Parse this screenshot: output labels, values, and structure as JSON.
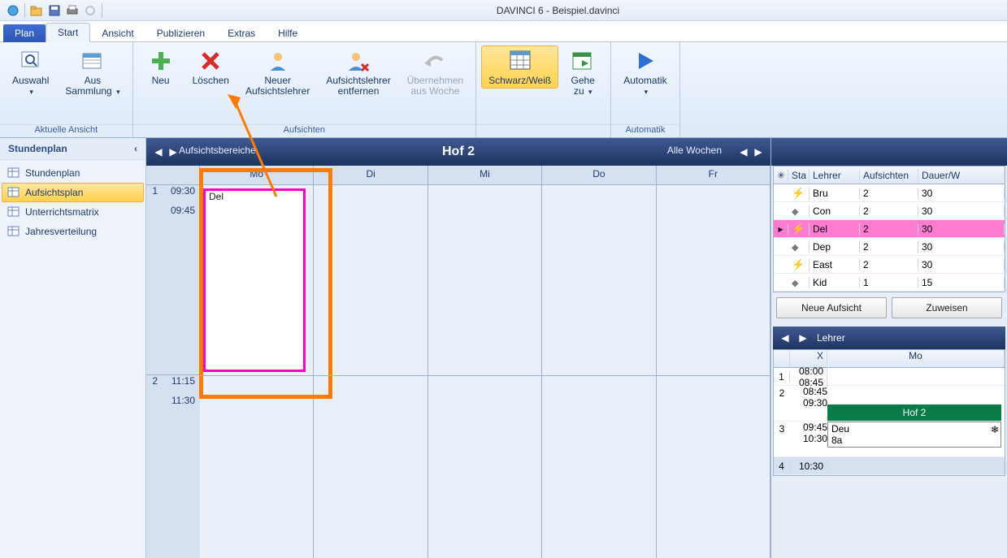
{
  "app_title": "DAVINCI 6 - Beispiel.davinci",
  "tabs": {
    "file": "Plan",
    "start": "Start",
    "ansicht": "Ansicht",
    "publizieren": "Publizieren",
    "extras": "Extras",
    "hilfe": "Hilfe"
  },
  "ribbon": {
    "aktuelle_ansicht": {
      "label": "Aktuelle Ansicht",
      "auswahl": "Auswahl",
      "aus_sammlung": "Aus\nSammlung"
    },
    "neu": "Neu",
    "loeschen": "Löschen",
    "neuer_al": "Neuer\nAufsichtslehrer",
    "al_entfernen": "Aufsichtslehrer\nentfernen",
    "uebernehmen": "Übernehmen\naus Woche",
    "aufsichten_group": "Aufsichten",
    "schwarzweiss": "Schwarz/Weiß",
    "gehe_zu": "Gehe\nzu",
    "automatik": "Automatik",
    "automatik_group": "Automatik"
  },
  "sidebar": {
    "title": "Stundenplan",
    "collapse": "‹",
    "items": [
      "Stundenplan",
      "Aufsichtsplan",
      "Unterrichtsmatrix",
      "Jahresverteilung"
    ]
  },
  "schedule": {
    "left_label": "Aufsichtsbereiche",
    "title": "Hof 2",
    "weeks": "Alle Wochen",
    "days": [
      "Mo",
      "Di",
      "Mi",
      "Do",
      "Fr"
    ],
    "rows": [
      {
        "n": "1",
        "t1": "09:30",
        "t2": "09:45"
      },
      {
        "n": "2",
        "t1": "11:15",
        "t2": "11:30"
      }
    ],
    "event_label": "Del"
  },
  "teacher_table": {
    "headers": {
      "star": "✳",
      "status": "Sta",
      "lehrer": "Lehrer",
      "aufsichten": "Aufsichten",
      "dauer": "Dauer/W"
    },
    "rows": [
      {
        "icon": "bolt",
        "name": "Bru",
        "a": "2",
        "d": "30"
      },
      {
        "icon": "diamond",
        "name": "Con",
        "a": "2",
        "d": "30"
      },
      {
        "icon": "bolt",
        "name": "Del",
        "a": "2",
        "d": "30",
        "selected": true
      },
      {
        "icon": "diamond",
        "name": "Dep",
        "a": "2",
        "d": "30"
      },
      {
        "icon": "bolt",
        "name": "East",
        "a": "2",
        "d": "30"
      },
      {
        "icon": "diamond",
        "name": "Kid",
        "a": "1",
        "d": "15"
      }
    ]
  },
  "buttons": {
    "neue_aufsicht": "Neue Aufsicht",
    "zuweisen": "Zuweisen"
  },
  "mini": {
    "title": "Lehrer",
    "header_x": "X",
    "header_mo": "Mo",
    "rows": [
      {
        "n": "1",
        "t1": "08:00",
        "t2": "08:45"
      },
      {
        "n": "2",
        "t1": "08:45",
        "t2": "09:30"
      },
      {
        "n": "3",
        "t1": "09:45",
        "t2": "10:30"
      },
      {
        "n": "4",
        "t1": "10:30",
        "t2": ""
      }
    ],
    "hof": "Hof 2",
    "deu": "Deu",
    "class": "8a"
  }
}
